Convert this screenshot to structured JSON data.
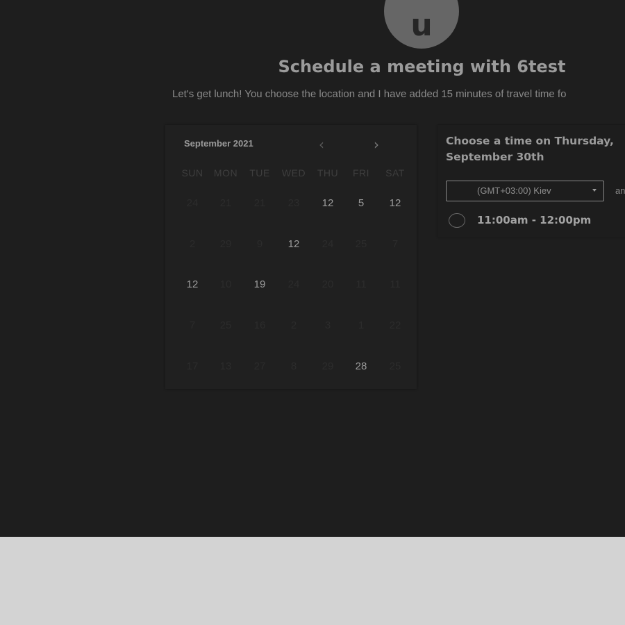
{
  "header": {
    "avatar_initial": "u",
    "title": "Schedule a meeting with 6test",
    "description": "Let's get lunch! You choose the location and I have added 15 minutes of travel time fo"
  },
  "calendar": {
    "month_label": "September 2021",
    "prev_icon": "‹",
    "next_icon": "›",
    "weekdays": [
      "SUN",
      "MON",
      "TUE",
      "WED",
      "THU",
      "FRI",
      "SAT"
    ],
    "weeks": [
      [
        {
          "label": "24",
          "available": false
        },
        {
          "label": "21",
          "available": false
        },
        {
          "label": "21",
          "available": false
        },
        {
          "label": "23",
          "available": false
        },
        {
          "label": "12",
          "available": true
        },
        {
          "label": "5",
          "available": true
        },
        {
          "label": "12",
          "available": true
        }
      ],
      [
        {
          "label": "2",
          "available": false
        },
        {
          "label": "29",
          "available": false
        },
        {
          "label": "9",
          "available": false
        },
        {
          "label": "12",
          "available": true
        },
        {
          "label": "24",
          "available": false
        },
        {
          "label": "25",
          "available": false
        },
        {
          "label": "7",
          "available": false
        }
      ],
      [
        {
          "label": "12",
          "available": true
        },
        {
          "label": "10",
          "available": false
        },
        {
          "label": "19",
          "available": true
        },
        {
          "label": "24",
          "available": false
        },
        {
          "label": "20",
          "available": false
        },
        {
          "label": "11",
          "available": false
        },
        {
          "label": "11",
          "available": false
        }
      ],
      [
        {
          "label": "7",
          "available": false
        },
        {
          "label": "25",
          "available": false
        },
        {
          "label": "16",
          "available": false
        },
        {
          "label": "2",
          "available": false
        },
        {
          "label": "3",
          "available": false
        },
        {
          "label": "1",
          "available": false
        },
        {
          "label": "22",
          "available": false
        }
      ],
      [
        {
          "label": "17",
          "available": false
        },
        {
          "label": "13",
          "available": false
        },
        {
          "label": "27",
          "available": false
        },
        {
          "label": "8",
          "available": false
        },
        {
          "label": "29",
          "available": false
        },
        {
          "label": "28",
          "available": true
        },
        {
          "label": "25",
          "available": false
        }
      ]
    ]
  },
  "time_panel": {
    "heading": "Choose a time on Thursday, September 30th",
    "timezone": "(GMT+03:00) Kiev",
    "timezone_extra": "an",
    "slots": [
      {
        "label": "11:00am - 12:00pm"
      }
    ]
  },
  "colors": {
    "background_dark": "#1e1e1e",
    "background_light": "#d3d3d3",
    "avatar": "#666666"
  }
}
